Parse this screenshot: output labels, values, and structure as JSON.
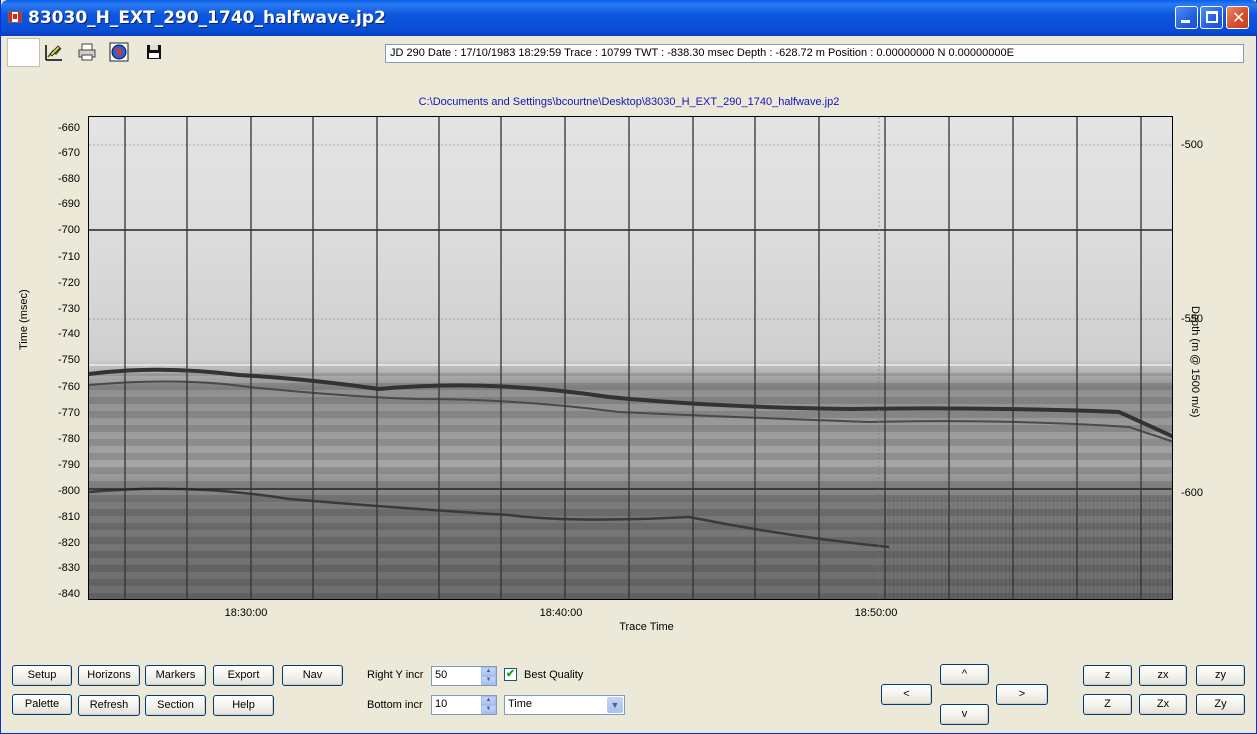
{
  "window": {
    "title": "83030_H_EXT_290_1740_halfwave.jp2"
  },
  "toolbar": {
    "status": "JD 290 Date : 17/10/1983 18:29:59  Trace : 10799  TWT : -838.30 msec  Depth : -628.72 m  Position : 0.00000000 N 0.00000000E",
    "icons": [
      "edit-chart-icon",
      "print-icon",
      "globe-map-icon",
      "save-disk-icon"
    ]
  },
  "plot": {
    "file_path": "C:\\Documents and Settings\\bcourtne\\Desktop\\83030_H_EXT_290_1740_halfwave.jp2",
    "y_label": "Time (msec)",
    "right_label": "Depth (m @ 1500 m/s)",
    "x_label": "Trace Time",
    "y_ticks": [
      "-660",
      "-670",
      "-680",
      "-690",
      "-700",
      "-710",
      "-720",
      "-730",
      "-740",
      "-750",
      "-760",
      "-770",
      "-780",
      "-790",
      "-800",
      "-810",
      "-820",
      "-830",
      "-840"
    ],
    "right_ticks": [
      "-500",
      "-550",
      "-600"
    ],
    "x_ticks": [
      "18:30:00",
      "18:40:00",
      "18:50:00"
    ]
  },
  "controls": {
    "buttons_row1": [
      "Setup",
      "Horizons",
      "Markers",
      "Export",
      "Nav"
    ],
    "buttons_row2": [
      "Palette",
      "Refresh",
      "Section",
      "Help"
    ],
    "right_y_label": "Right Y incr",
    "right_y_value": "50",
    "bottom_label": "Bottom  incr",
    "bottom_value": "10",
    "best_quality_label": "Best Quality",
    "best_quality_checked": true,
    "mode_value": "Time",
    "nav": {
      "up": "^",
      "left": "<",
      "right": ">",
      "down": "v"
    },
    "zoom_row1": [
      "z",
      "zx",
      "zy"
    ],
    "zoom_row2": [
      "Z",
      "Zx",
      "Zy"
    ]
  }
}
